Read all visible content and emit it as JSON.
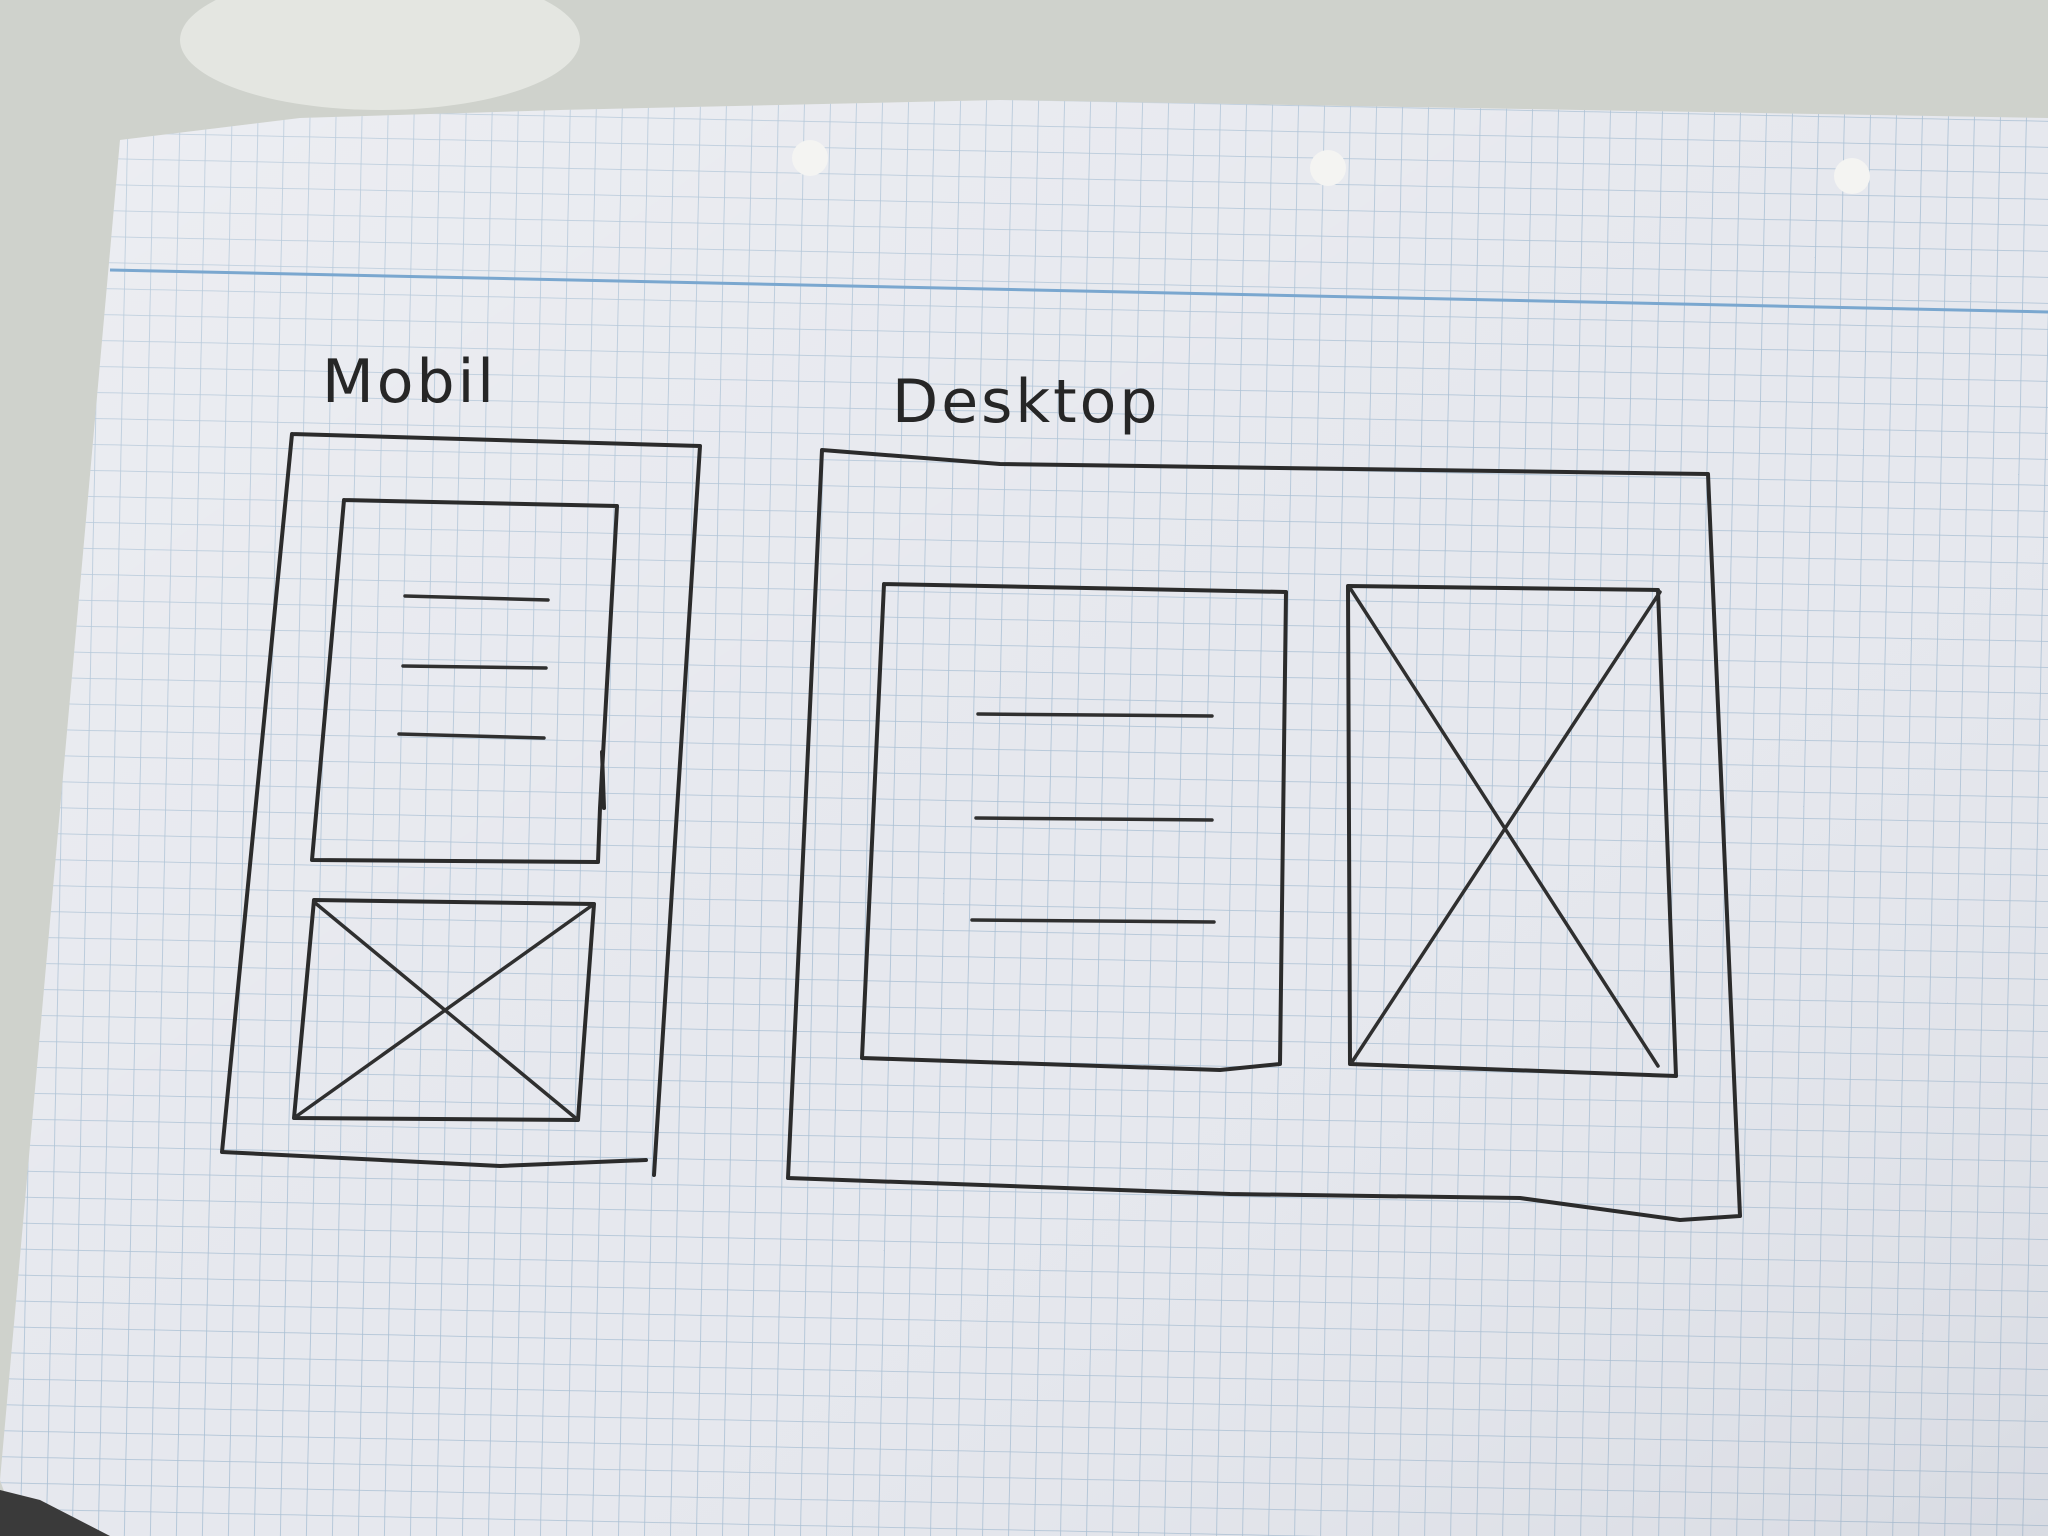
{
  "sketches": {
    "mobile": {
      "label": "Mobil"
    },
    "desktop": {
      "label": "Desktop"
    }
  },
  "colors": {
    "paper": "#e6e8ee",
    "grid": "#a9bfd3",
    "margin_line": "#7aa7cf",
    "ink": "#2b2b2b",
    "background": "#cfd2cc"
  },
  "icons": {
    "image_placeholder": "crossed-box-icon",
    "text_lines": "text-lines-icon"
  }
}
